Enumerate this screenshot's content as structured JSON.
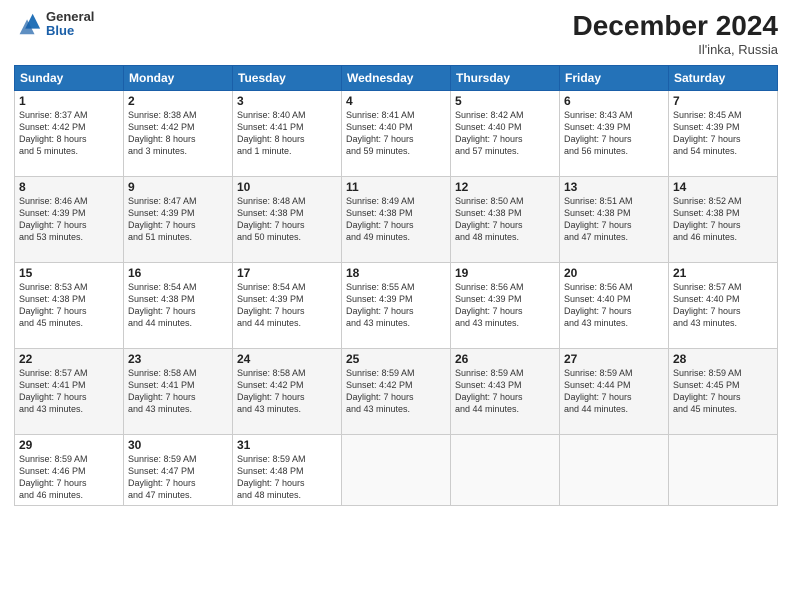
{
  "header": {
    "logo_general": "General",
    "logo_blue": "Blue",
    "title": "December 2024",
    "location": "Il'inka, Russia"
  },
  "days_of_week": [
    "Sunday",
    "Monday",
    "Tuesday",
    "Wednesday",
    "Thursday",
    "Friday",
    "Saturday"
  ],
  "weeks": [
    [
      {
        "day": "1",
        "info": "Sunrise: 8:37 AM\nSunset: 4:42 PM\nDaylight: 8 hours\nand 5 minutes."
      },
      {
        "day": "2",
        "info": "Sunrise: 8:38 AM\nSunset: 4:42 PM\nDaylight: 8 hours\nand 3 minutes."
      },
      {
        "day": "3",
        "info": "Sunrise: 8:40 AM\nSunset: 4:41 PM\nDaylight: 8 hours\nand 1 minute."
      },
      {
        "day": "4",
        "info": "Sunrise: 8:41 AM\nSunset: 4:40 PM\nDaylight: 7 hours\nand 59 minutes."
      },
      {
        "day": "5",
        "info": "Sunrise: 8:42 AM\nSunset: 4:40 PM\nDaylight: 7 hours\nand 57 minutes."
      },
      {
        "day": "6",
        "info": "Sunrise: 8:43 AM\nSunset: 4:39 PM\nDaylight: 7 hours\nand 56 minutes."
      },
      {
        "day": "7",
        "info": "Sunrise: 8:45 AM\nSunset: 4:39 PM\nDaylight: 7 hours\nand 54 minutes."
      }
    ],
    [
      {
        "day": "8",
        "info": "Sunrise: 8:46 AM\nSunset: 4:39 PM\nDaylight: 7 hours\nand 53 minutes."
      },
      {
        "day": "9",
        "info": "Sunrise: 8:47 AM\nSunset: 4:39 PM\nDaylight: 7 hours\nand 51 minutes."
      },
      {
        "day": "10",
        "info": "Sunrise: 8:48 AM\nSunset: 4:38 PM\nDaylight: 7 hours\nand 50 minutes."
      },
      {
        "day": "11",
        "info": "Sunrise: 8:49 AM\nSunset: 4:38 PM\nDaylight: 7 hours\nand 49 minutes."
      },
      {
        "day": "12",
        "info": "Sunrise: 8:50 AM\nSunset: 4:38 PM\nDaylight: 7 hours\nand 48 minutes."
      },
      {
        "day": "13",
        "info": "Sunrise: 8:51 AM\nSunset: 4:38 PM\nDaylight: 7 hours\nand 47 minutes."
      },
      {
        "day": "14",
        "info": "Sunrise: 8:52 AM\nSunset: 4:38 PM\nDaylight: 7 hours\nand 46 minutes."
      }
    ],
    [
      {
        "day": "15",
        "info": "Sunrise: 8:53 AM\nSunset: 4:38 PM\nDaylight: 7 hours\nand 45 minutes."
      },
      {
        "day": "16",
        "info": "Sunrise: 8:54 AM\nSunset: 4:38 PM\nDaylight: 7 hours\nand 44 minutes."
      },
      {
        "day": "17",
        "info": "Sunrise: 8:54 AM\nSunset: 4:39 PM\nDaylight: 7 hours\nand 44 minutes."
      },
      {
        "day": "18",
        "info": "Sunrise: 8:55 AM\nSunset: 4:39 PM\nDaylight: 7 hours\nand 43 minutes."
      },
      {
        "day": "19",
        "info": "Sunrise: 8:56 AM\nSunset: 4:39 PM\nDaylight: 7 hours\nand 43 minutes."
      },
      {
        "day": "20",
        "info": "Sunrise: 8:56 AM\nSunset: 4:40 PM\nDaylight: 7 hours\nand 43 minutes."
      },
      {
        "day": "21",
        "info": "Sunrise: 8:57 AM\nSunset: 4:40 PM\nDaylight: 7 hours\nand 43 minutes."
      }
    ],
    [
      {
        "day": "22",
        "info": "Sunrise: 8:57 AM\nSunset: 4:41 PM\nDaylight: 7 hours\nand 43 minutes."
      },
      {
        "day": "23",
        "info": "Sunrise: 8:58 AM\nSunset: 4:41 PM\nDaylight: 7 hours\nand 43 minutes."
      },
      {
        "day": "24",
        "info": "Sunrise: 8:58 AM\nSunset: 4:42 PM\nDaylight: 7 hours\nand 43 minutes."
      },
      {
        "day": "25",
        "info": "Sunrise: 8:59 AM\nSunset: 4:42 PM\nDaylight: 7 hours\nand 43 minutes."
      },
      {
        "day": "26",
        "info": "Sunrise: 8:59 AM\nSunset: 4:43 PM\nDaylight: 7 hours\nand 44 minutes."
      },
      {
        "day": "27",
        "info": "Sunrise: 8:59 AM\nSunset: 4:44 PM\nDaylight: 7 hours\nand 44 minutes."
      },
      {
        "day": "28",
        "info": "Sunrise: 8:59 AM\nSunset: 4:45 PM\nDaylight: 7 hours\nand 45 minutes."
      }
    ],
    [
      {
        "day": "29",
        "info": "Sunrise: 8:59 AM\nSunset: 4:46 PM\nDaylight: 7 hours\nand 46 minutes."
      },
      {
        "day": "30",
        "info": "Sunrise: 8:59 AM\nSunset: 4:47 PM\nDaylight: 7 hours\nand 47 minutes."
      },
      {
        "day": "31",
        "info": "Sunrise: 8:59 AM\nSunset: 4:48 PM\nDaylight: 7 hours\nand 48 minutes."
      },
      null,
      null,
      null,
      null
    ]
  ]
}
